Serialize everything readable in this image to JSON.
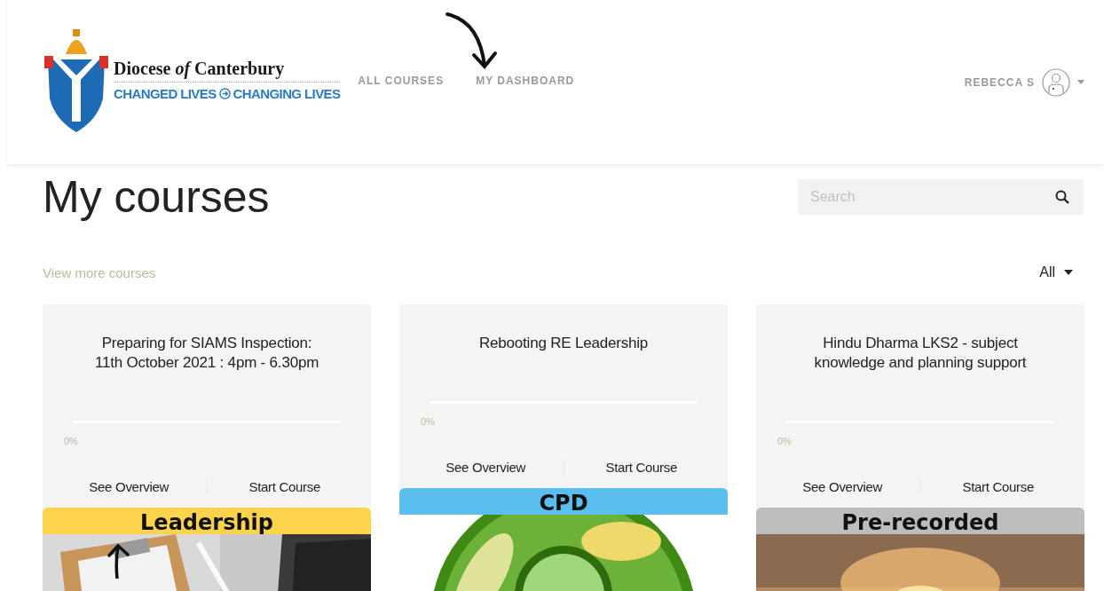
{
  "header": {
    "logo": {
      "title": "Diocese *of* Canterbury",
      "tagline_left": "CHANGED LIVES",
      "tagline_right": "CHANGING LIVES"
    },
    "nav": [
      {
        "label": "ALL COURSES"
      },
      {
        "label": "MY DASHBOARD"
      }
    ],
    "user": {
      "name": "REBECCA S"
    }
  },
  "page_title": "My courses",
  "search": {
    "placeholder": "Search"
  },
  "view_more": "View more courses",
  "filter": {
    "value": "All"
  },
  "courses": [
    {
      "title": "Preparing for SIAMS Inspection: 11th October 2021 : 4pm - 6.30pm",
      "level": 0,
      "progress": "0%",
      "actions": [
        "See Overview",
        "Start Course"
      ],
      "tag": {
        "label": "Leadership",
        "color": "#fbd44c"
      }
    },
    {
      "title": "Rebooting RE Leadership",
      "level": 0,
      "progress": "0%",
      "actions": [
        "See Overview",
        "Start Course"
      ],
      "tag": {
        "label": "CPD",
        "color": "#5bbfed"
      }
    },
    {
      "title": "Hindu Dharma LKS2 - subject knowledge and planning support",
      "level": 0,
      "progress": "0%",
      "actions": [
        "See Overview",
        "Start Course"
      ],
      "tag": {
        "label": "Pre-recorded",
        "color": "#bdbdbd"
      }
    }
  ]
}
